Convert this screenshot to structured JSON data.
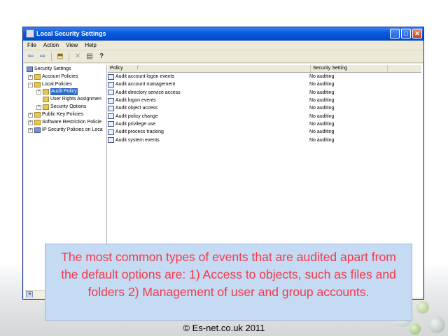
{
  "window": {
    "title": "Local Security Settings",
    "buttons": {
      "minimize": "_",
      "maximize": "□",
      "close": "✕"
    }
  },
  "menu": [
    "File",
    "Action",
    "View",
    "Help"
  ],
  "toolbar_icons": [
    "back-arrow-icon",
    "forward-arrow-icon",
    "up-folder-icon",
    "delete-icon",
    "properties-icon",
    "help-icon"
  ],
  "toolbar_glyphs": {
    "back": "⇦",
    "forward": "⇨",
    "up": "⬒",
    "delete": "✕",
    "properties": "▤",
    "help": "?"
  },
  "tree": [
    {
      "label": "Security Settings",
      "expander": "",
      "icon": "shield",
      "level": 0,
      "selected": false
    },
    {
      "label": "Account Policies",
      "expander": "+",
      "icon": "folder",
      "level": 1,
      "selected": false
    },
    {
      "label": "Local Policies",
      "expander": "−",
      "icon": "folder",
      "level": 1,
      "selected": false
    },
    {
      "label": "Audit Policy",
      "expander": "+",
      "icon": "folder",
      "level": 2,
      "selected": true
    },
    {
      "label": "User Rights Assignmen",
      "expander": "",
      "icon": "folder",
      "level": 2,
      "selected": false
    },
    {
      "label": "Security Options",
      "expander": "+",
      "icon": "folder",
      "level": 2,
      "selected": false
    },
    {
      "label": "Public Key Policies",
      "expander": "+",
      "icon": "folder",
      "level": 1,
      "selected": false
    },
    {
      "label": "Software Restriction Policie",
      "expander": "+",
      "icon": "folder",
      "level": 1,
      "selected": false
    },
    {
      "label": "IP Security Policies on Loca",
      "expander": "+",
      "icon": "shield",
      "level": 1,
      "selected": false
    }
  ],
  "list": {
    "columns": [
      "Policy",
      "Security Setting"
    ],
    "sort_glyph": "/",
    "rows": [
      {
        "policy": "Audit account logon events",
        "setting": "No auditing"
      },
      {
        "policy": "Audit account management",
        "setting": "No auditing"
      },
      {
        "policy": "Audit directory service access",
        "setting": "No auditing"
      },
      {
        "policy": "Audit logon events",
        "setting": "No auditing"
      },
      {
        "policy": "Audit object access",
        "setting": "No auditing"
      },
      {
        "policy": "Audit policy change",
        "setting": "No auditing"
      },
      {
        "policy": "Audit privilege use",
        "setting": "No auditing"
      },
      {
        "policy": "Audit process tracking",
        "setting": "No auditing"
      },
      {
        "policy": "Audit system events",
        "setting": "No auditing"
      }
    ]
  },
  "scroll_arrow": "◂",
  "caption": "The most common types of events that are audited apart from the default options are: 1) Access to objects, such as files and folders 2) Management of user and group accounts.",
  "copyright": "© Es-net.co.uk 2011",
  "colors": {
    "caption_text": "#f43a4a",
    "caption_bg": "#c5daf3",
    "titlebar": "#0a5ce0"
  }
}
